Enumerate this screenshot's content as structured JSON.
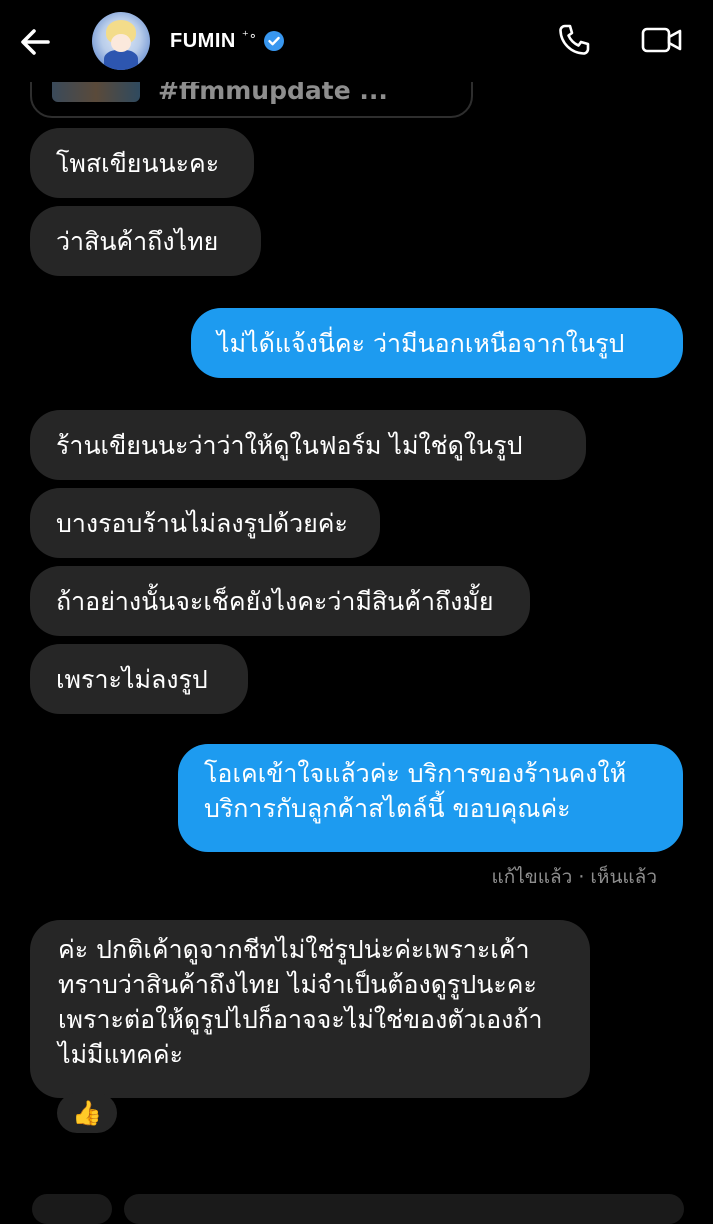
{
  "header": {
    "title": "FUMIN",
    "title_suffix": "⁺∘",
    "verified": true
  },
  "shared_post": {
    "caption": "#ffmmupdate ..."
  },
  "messages": [
    {
      "side": "in",
      "text": "โพสเขียนนะคะ"
    },
    {
      "side": "in",
      "text": "ว่าสินค้าถึงไทย"
    },
    {
      "side": "out",
      "text": "ไม่ได้แจ้งนี่คะ ว่ามีนอกเหนือจากในรูป"
    },
    {
      "side": "in",
      "text": "ร้านเขียนนะว่าว่าให้ดูในฟอร์ม ไม่ใช่ดูในรูป"
    },
    {
      "side": "in",
      "text": "บางรอบร้านไม่ลงรูปด้วยค่ะ"
    },
    {
      "side": "in",
      "text": "ถ้าอย่างนั้นจะเช็คยังไงคะว่ามีสินค้าถึงมั้ย"
    },
    {
      "side": "in",
      "text": "เพราะไม่ลงรูป"
    },
    {
      "side": "out",
      "text": "โอเคเข้าใจแล้วค่ะ บริการของร้านคงให้บริการกับลูกค้าสไตล์นี้ ขอบคุณค่ะ"
    },
    {
      "side": "in",
      "text": "ค่ะ ปกติเค้าดูจากชีทไม่ใช่รูปน่ะค่ะเพราะเค้าทราบว่าสินค้าถึงไทย ไม่จำเป็นต้องดูรูปนะคะ เพราะต่อให้ดูรูปไปก็อาจจะไม่ใช่ของตัวเองถ้าไม่มีแทคค่ะ"
    }
  ],
  "status_line": "แก้ไขแล้ว · เห็นแล้ว",
  "reaction": "👍",
  "colors": {
    "background": "#000000",
    "incoming_bubble": "#262626",
    "outgoing_bubble": "#1d9bf0",
    "muted_text": "#8e8e8e",
    "verified_badge": "#3897f0"
  }
}
